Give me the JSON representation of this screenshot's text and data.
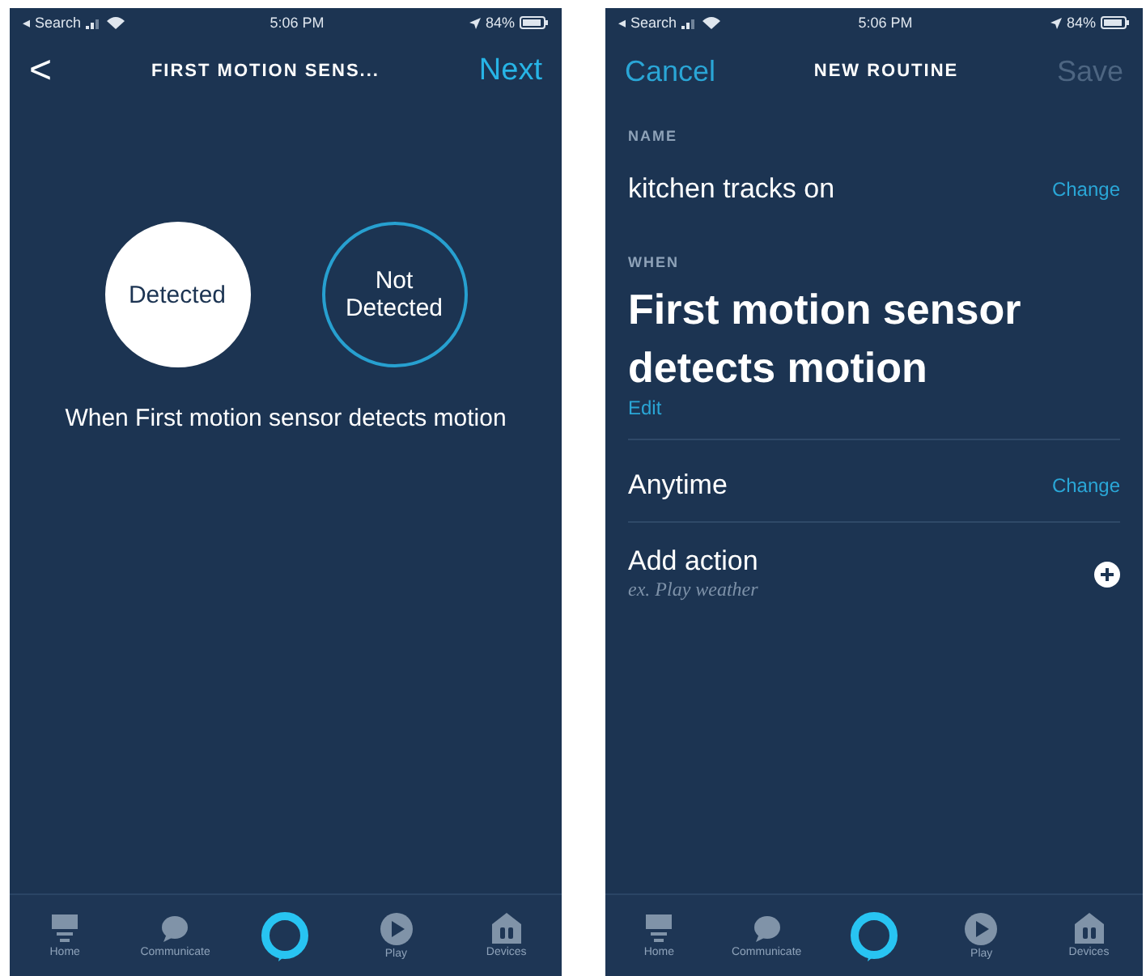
{
  "left_screen": {
    "status_bar": {
      "back_app": "◂ Search",
      "time": "5:06 PM",
      "battery": "84%"
    },
    "nav": {
      "back": "<",
      "title": "FIRST MOTION SENS...",
      "action": "Next"
    },
    "options": [
      {
        "label": "Detected",
        "selected": true
      },
      {
        "label": "Not Detected",
        "selected": false
      }
    ],
    "description": "When First motion sensor detects motion",
    "tab_bar": [
      {
        "kind": "home",
        "label": "Home"
      },
      {
        "kind": "communicate",
        "label": "Communicate"
      },
      {
        "kind": "alexa"
      },
      {
        "kind": "play",
        "label": "Play"
      },
      {
        "kind": "devices",
        "label": "Devices"
      }
    ]
  },
  "right_screen": {
    "status_bar": {
      "back_app": "◂ Search",
      "time": "5:06 PM",
      "battery": "84%"
    },
    "nav": {
      "cancel": "Cancel",
      "title": "NEW ROUTINE",
      "save": "Save",
      "save_disabled": true
    },
    "name_label": "NAME",
    "name": "kitchen tracks on",
    "name_change": "Change",
    "when_label": "WHEN",
    "trigger": "First motion sensor detects motion",
    "trigger_edit": "Edit",
    "schedule": "Anytime",
    "schedule_change": "Change",
    "add_action": "Add action",
    "add_action_hint": "ex. Play weather",
    "tab_bar": [
      {
        "kind": "home",
        "label": "Home"
      },
      {
        "kind": "communicate",
        "label": "Communicate"
      },
      {
        "kind": "alexa"
      },
      {
        "kind": "play",
        "label": "Play"
      },
      {
        "kind": "devices",
        "label": "Devices"
      }
    ]
  }
}
